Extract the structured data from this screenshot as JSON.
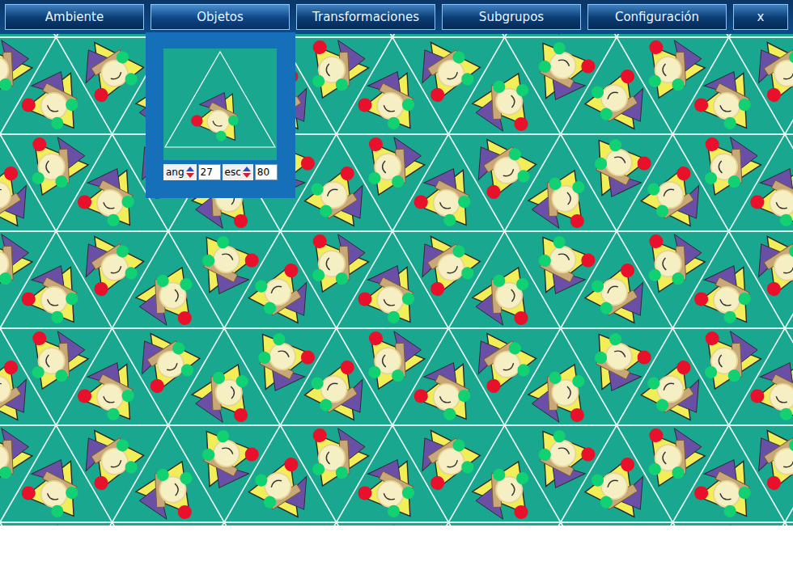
{
  "menu": [
    {
      "label": "Ambiente",
      "selected": false
    },
    {
      "label": "Objetos",
      "selected": true
    },
    {
      "label": "Transformaciones",
      "selected": false
    },
    {
      "label": "Subgrupos",
      "selected": false
    },
    {
      "label": "Configuración",
      "selected": false
    },
    {
      "label": "x",
      "selected": false
    }
  ],
  "objects_panel": {
    "open": true,
    "controls": [
      {
        "label": "ang",
        "value": "27"
      },
      {
        "label": "esc",
        "value": "80"
      }
    ]
  }
}
